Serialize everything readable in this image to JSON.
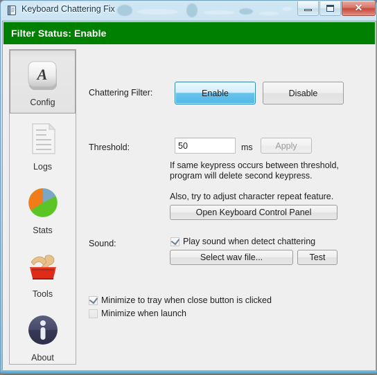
{
  "window": {
    "title": "Keyboard Chattering Fix",
    "app_icon": "notepad-icon",
    "controls": {
      "minimize": "Minimize",
      "maximize": "Maximize",
      "close": "✕"
    }
  },
  "status_banner": {
    "text": "Filter Status: Enable",
    "background": "#008000",
    "color": "#ffffff"
  },
  "sidebar": {
    "items": [
      {
        "label": "Config",
        "icon": "keyboard-key-a-icon",
        "selected": true
      },
      {
        "label": "Logs",
        "icon": "document-icon",
        "selected": false
      },
      {
        "label": "Stats",
        "icon": "pie-chart-icon",
        "selected": false
      },
      {
        "label": "Tools",
        "icon": "toolbox-icon",
        "selected": false
      },
      {
        "label": "About",
        "icon": "info-circle-icon",
        "selected": false
      }
    ]
  },
  "config": {
    "filter_label": "Chattering Filter:",
    "enable_button": "Enable",
    "disable_button": "Disable",
    "threshold_label": "Threshold:",
    "threshold_value": "50",
    "threshold_unit": "ms",
    "apply_button": "Apply",
    "help_line1": "If same keypress occurs between threshold,",
    "help_line2": "program will delete second keypress.",
    "help_line3": "Also, try to adjust character repeat feature.",
    "control_panel_button": "Open Keyboard Control Panel",
    "sound_label": "Sound:",
    "play_sound_checkbox": "Play sound when detect chattering",
    "play_sound_checked": true,
    "select_wav_button": "Select wav file...",
    "test_button": "Test",
    "minimize_tray_checkbox": "Minimize to tray when close button is clicked",
    "minimize_tray_checked": true,
    "minimize_launch_checkbox": "Minimize when launch",
    "minimize_launch_checked": false
  },
  "colors": {
    "accent_blue": "#52b8e6",
    "status_green": "#008000",
    "window_bg": "#efefef"
  }
}
